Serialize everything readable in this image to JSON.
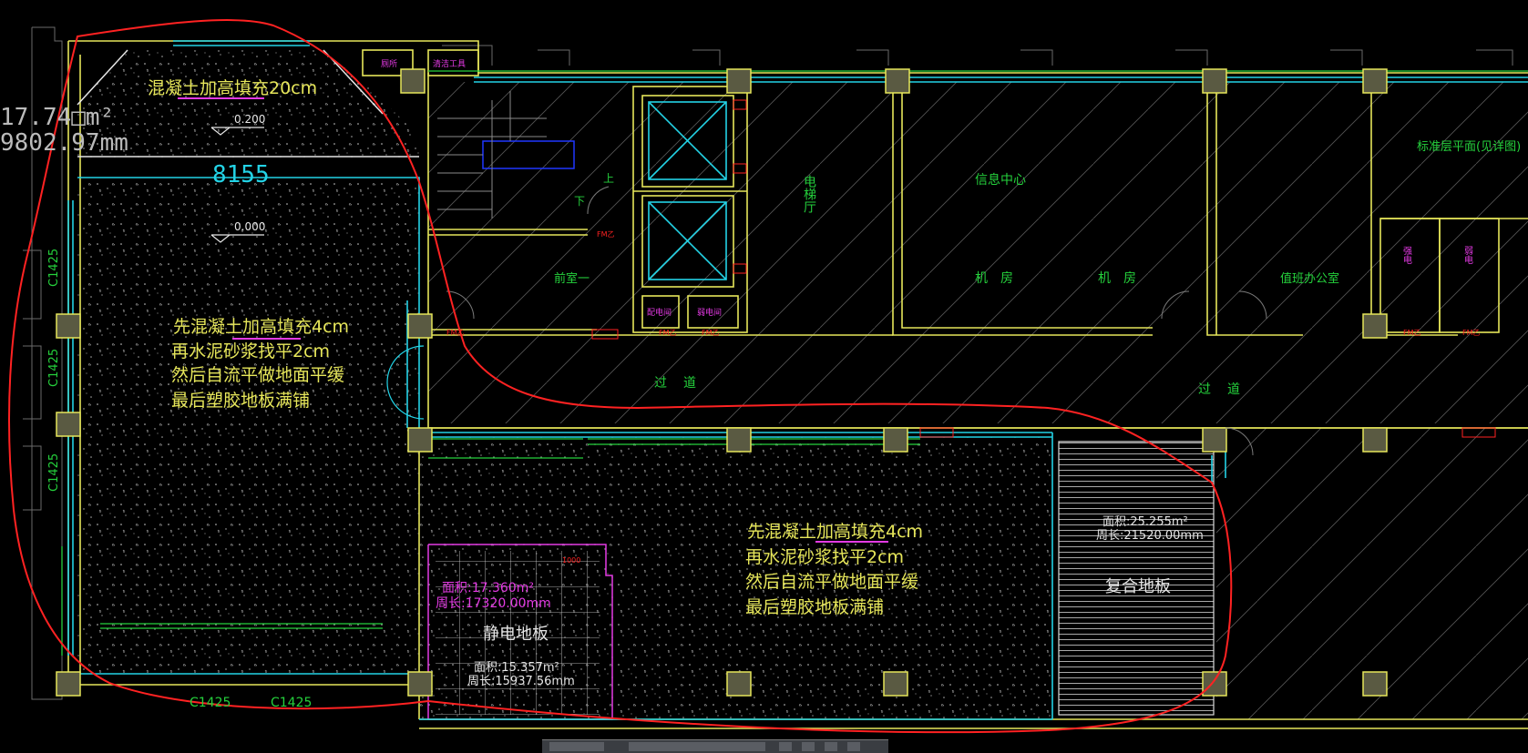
{
  "labels": {
    "fill_20cm": "混凝土加高填充20cm",
    "elev_top": "0.200",
    "elev_mid": "0.000",
    "dim_width": "8155",
    "area_partial": "17.74□m²",
    "perimeter_partial": "9802.97mm",
    "note_left_line1": "先混凝土加高填充4cm",
    "note_left_line2": "再水泥砂浆找平2cm",
    "note_left_line3": "然后自流平做地面平缓",
    "note_left_line4": "最后塑胶地板满铺",
    "note_right_line1": "先混凝土加高填充4cm",
    "note_right_line2": "再水泥砂浆找平2cm",
    "note_right_line3": "然后自流平做地面平缓",
    "note_right_line4": "最后塑胶地板满铺",
    "window_c1425": "C1425",
    "room_elevator_hall": "电梯厅",
    "room_info_center": "信息中心",
    "room_machine_1": "机房",
    "room_machine_2": "机房",
    "room_lobby": "前室一",
    "room_duty": "值班办公室",
    "corridor_1": "过道",
    "corridor_2": "过道",
    "std_floor_note": "标准层平面(见详图)",
    "stair_up": "上",
    "stair_down": "下",
    "static_floor": "静电地板",
    "static_area": "面积:17.360m²",
    "static_perimeter": "周长:17320.00mm",
    "small_area": "面积:15.357m²",
    "small_perimeter": "周长:15937.56mm",
    "composite_floor": "复合地板",
    "composite_area": "面积:25.255m²",
    "composite_perimeter": "周长:21520.00mm",
    "small_room_1": "厕所",
    "small_room_2": "清洁工具",
    "small_room_3": "配电间",
    "small_room_4": "弱电间",
    "small_room_5": "强电",
    "small_room_6": "弱电",
    "door_tag": "FM乙",
    "dim_1000": "1000"
  },
  "colors": {
    "background": "#000000",
    "wall_yellow": "#e6e65a",
    "wall_cyan": "#23d3e6",
    "green": "#25d13c",
    "red_outline": "#ff2222",
    "magenta": "#e43ae4",
    "white": "#e6e6e6",
    "blue": "#1f37ff",
    "column_fill": "#5a5a42"
  }
}
